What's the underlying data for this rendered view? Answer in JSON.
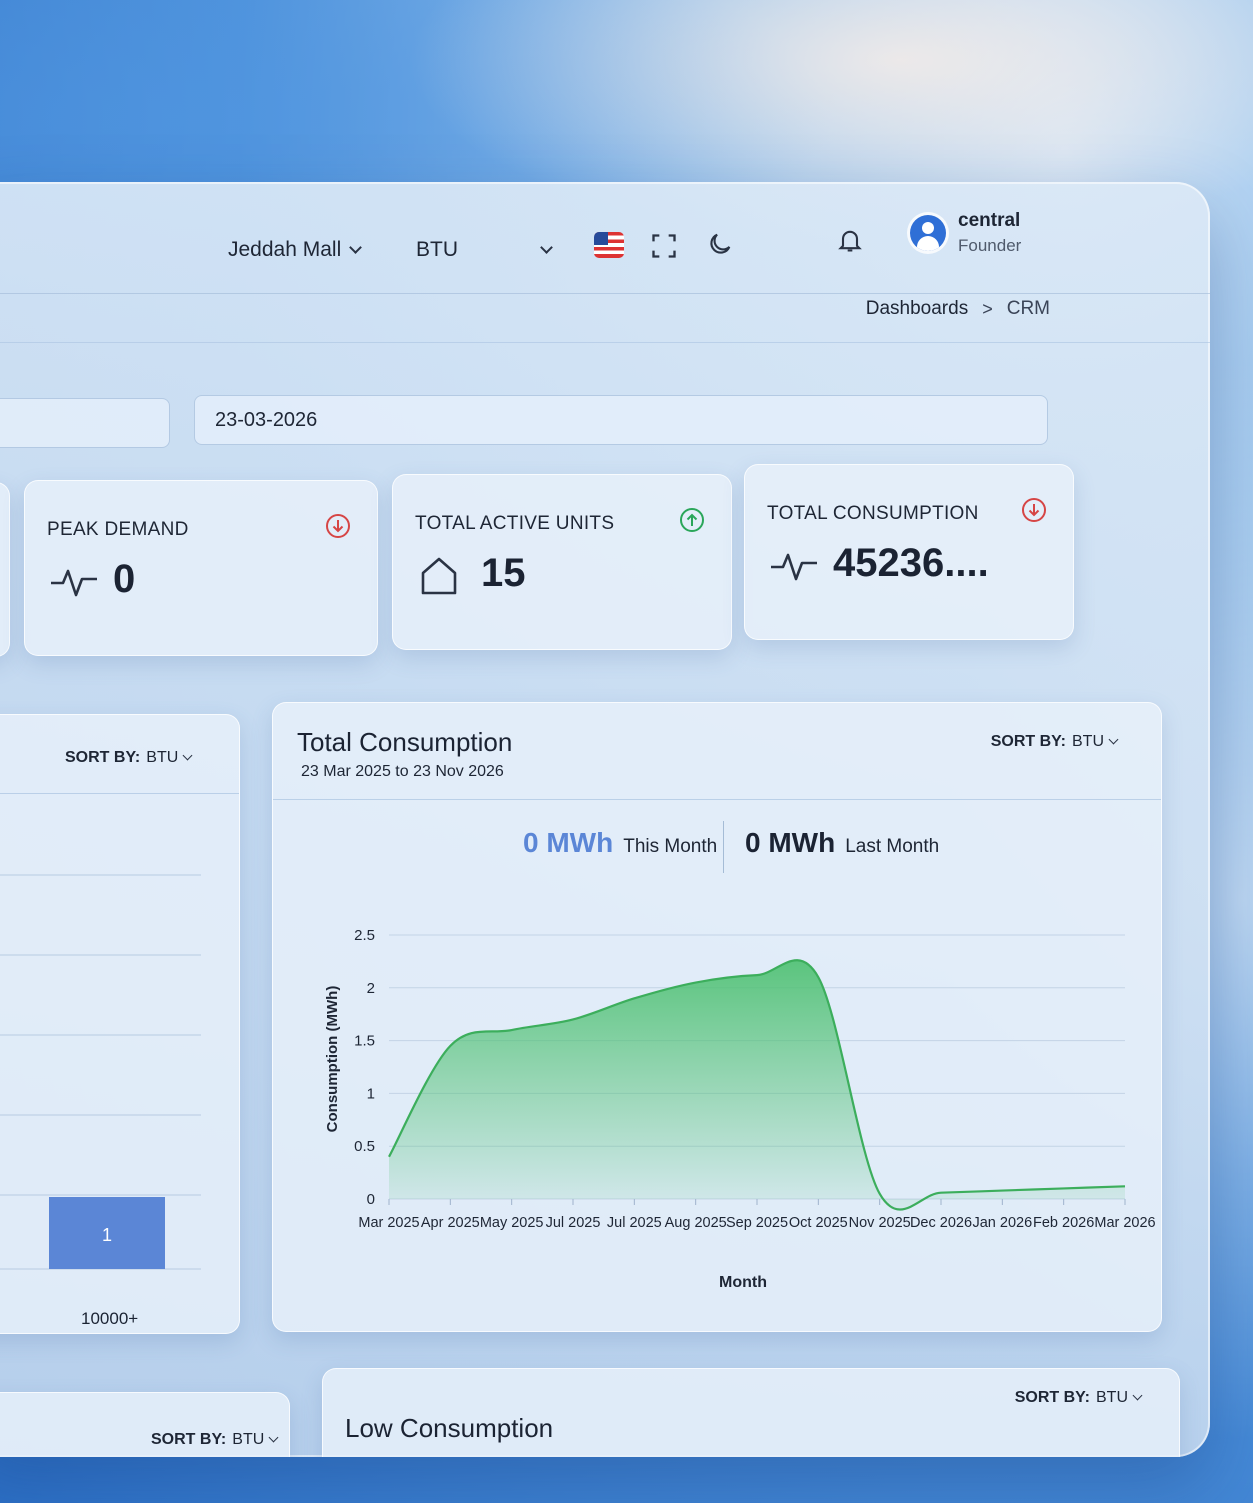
{
  "header": {
    "site_selector": "Jeddah Mall",
    "unit_selector": "BTU",
    "flag_icon": "us-flag-icon",
    "user": {
      "name": "central",
      "role": "Founder"
    }
  },
  "breadcrumb": {
    "parent": "Dashboards",
    "separator": ">",
    "current": "CRM"
  },
  "filters": {
    "date": "23-03-2026"
  },
  "stats": [
    {
      "title": "PEAK DEMAND",
      "value": "0",
      "icon": "pulse-icon",
      "trend": "down",
      "trend_color": "#d64545"
    },
    {
      "title": "TOTAL ACTIVE UNITS",
      "value": "15",
      "icon": "home-icon",
      "trend": "up",
      "trend_color": "#2aa65a"
    },
    {
      "title": "TOTAL CONSUMPTION",
      "value": "45236....",
      "icon": "pulse-icon",
      "trend": "down",
      "trend_color": "#d64545"
    }
  ],
  "left_panel": {
    "sort_label": "SORT BY:",
    "sort_value": "BTU",
    "bar_value": "1",
    "bar_category": "10000+",
    "bar_color": "#5b86d6"
  },
  "consumption_panel": {
    "title": "Total Consumption",
    "subtitle": "23 Mar 2025 to 23 Nov 2026",
    "sort_label": "SORT BY:",
    "sort_value": "BTU",
    "this_month_value": "0 MWh",
    "this_month_label": "This Month",
    "last_month_value": "0 MWh",
    "last_month_label": "Last Month",
    "accent_color": "#5b86d6"
  },
  "bottom_panels": {
    "left_sort_label": "SORT BY:",
    "left_sort_value": "BTU",
    "right_title": "Low Consumption",
    "right_sort_label": "SORT BY:",
    "right_sort_value": "BTU"
  },
  "chart_data": {
    "type": "area",
    "xlabel": "Month",
    "ylabel": "Consumption (MWh)",
    "ylim": [
      0,
      2.5
    ],
    "yticks": [
      "0",
      "0.5",
      "1",
      "1.5",
      "2",
      "2.5"
    ],
    "grid": true,
    "categories": [
      "Mar 2025",
      "Apr 2025",
      "May 2025",
      "Jul 2025",
      "Jul 2025",
      "Aug 2025",
      "Sep 2025",
      "Oct 2025",
      "Nov 2025",
      "Dec 2026",
      "Jan 2026",
      "Feb 2026",
      "Mar 2026"
    ],
    "series": [
      {
        "values": [
          0.4,
          1.45,
          1.6,
          1.7,
          1.9,
          2.05,
          2.12,
          2.1,
          0.05,
          0.06,
          0.08,
          0.1,
          0.12
        ],
        "color": "#3cae5c"
      }
    ]
  }
}
